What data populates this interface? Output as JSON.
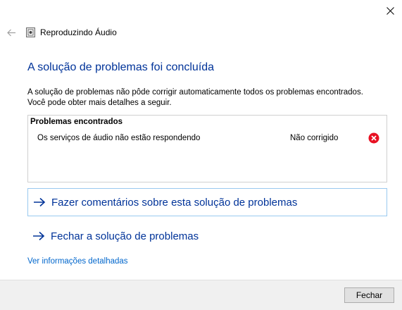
{
  "window": {
    "title": "Reproduzindo Áudio",
    "close_icon": "close-icon",
    "back_icon": "back-arrow-icon",
    "app_icon": "audio-troubleshooter-icon"
  },
  "main": {
    "heading": "A solução de problemas foi concluída",
    "description_line1": "A solução de problemas não pôde corrigir automaticamente todos os problemas encontrados.",
    "description_line2": "Você pode obter mais detalhes a seguir."
  },
  "problems": {
    "header": "Problemas encontrados",
    "items": [
      {
        "name": "Os serviços de áudio não estão respondendo",
        "status": "Não corrigido",
        "status_icon": "error-icon"
      }
    ]
  },
  "actions": {
    "feedback_label": "Fazer comentários sobre esta solução de problemas",
    "close_troubleshooter_label": "Fechar a solução de problemas",
    "details_link": "Ver informações detalhadas"
  },
  "footer": {
    "close_button_label": "Fechar"
  },
  "colors": {
    "heading": "#003399",
    "link": "#0066cc",
    "error": "#e81123",
    "focus_border": "#99c9ef"
  }
}
